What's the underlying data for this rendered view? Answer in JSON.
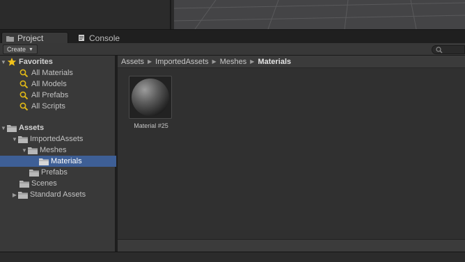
{
  "tabs": [
    {
      "label": "Project",
      "icon": "folder-icon",
      "active": true
    },
    {
      "label": "Console",
      "icon": "console-icon",
      "active": false
    }
  ],
  "toolbar": {
    "create_label": "Create",
    "search_placeholder": ""
  },
  "favorites": {
    "label": "Favorites",
    "items": [
      {
        "label": "All Materials"
      },
      {
        "label": "All Models"
      },
      {
        "label": "All Prefabs"
      },
      {
        "label": "All Scripts"
      }
    ]
  },
  "assets_tree": {
    "label": "Assets",
    "imported": "ImportedAssets",
    "meshes": "Meshes",
    "materials": "Materials",
    "prefabs": "Prefabs",
    "scenes": "Scenes",
    "standard_assets": "Standard Assets"
  },
  "breadcrumb": {
    "items": [
      "Assets",
      "ImportedAssets",
      "Meshes"
    ],
    "current": "Materials"
  },
  "asset_grid": [
    {
      "label": "Material #25",
      "type": "material"
    }
  ],
  "colors": {
    "selection": "#3e5f96",
    "favorite_star": "#f2c21b",
    "search_icon": "#d9b414"
  }
}
